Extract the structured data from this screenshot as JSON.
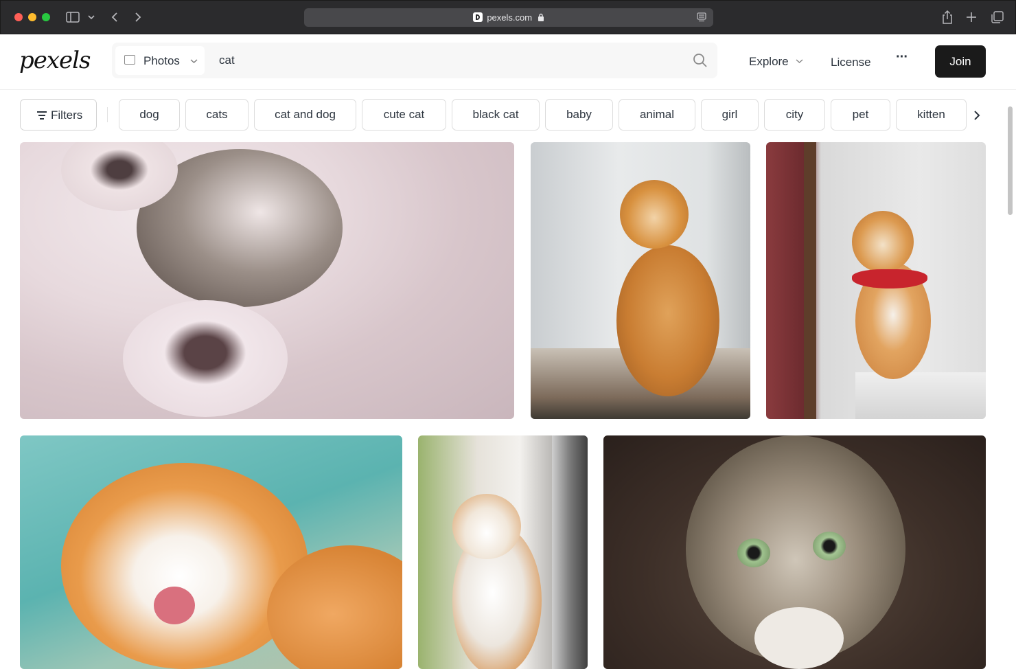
{
  "browser": {
    "url_domain": "pexels.com",
    "lock_icon": "lock-icon",
    "sidebar_icon": "sidebar-icon",
    "back_icon": "chevron-left-icon",
    "forward_icon": "chevron-right-icon",
    "share_icon": "share-icon",
    "new_tab_icon": "plus-icon",
    "tabs_icon": "tabs-overview-icon",
    "reader_icon": "reader-icon"
  },
  "header": {
    "logo": "pexels",
    "search_type": "Photos",
    "search_query": "cat",
    "nav": {
      "explore": "Explore",
      "license": "License",
      "more": "···",
      "join": "Join"
    }
  },
  "filters": {
    "button_label": "Filters",
    "chips": [
      "dog",
      "cats",
      "cat and dog",
      "cute cat",
      "black cat",
      "baby",
      "animal",
      "girl",
      "city",
      "pet",
      "kitten"
    ]
  },
  "photos": [
    {
      "subject": "sleeping kitten with paws up"
    },
    {
      "subject": "orange tabby cat sitting by window"
    },
    {
      "subject": "orange cat with red bandana"
    },
    {
      "subject": "orange and white cat licking paw"
    },
    {
      "subject": "white and orange cat looking up"
    },
    {
      "subject": "tabby cat close-up looking up"
    }
  ],
  "colors": {
    "chrome_bg": "#2b2b2d",
    "join_bg": "#1a1a1a",
    "text": "#2c343e"
  }
}
